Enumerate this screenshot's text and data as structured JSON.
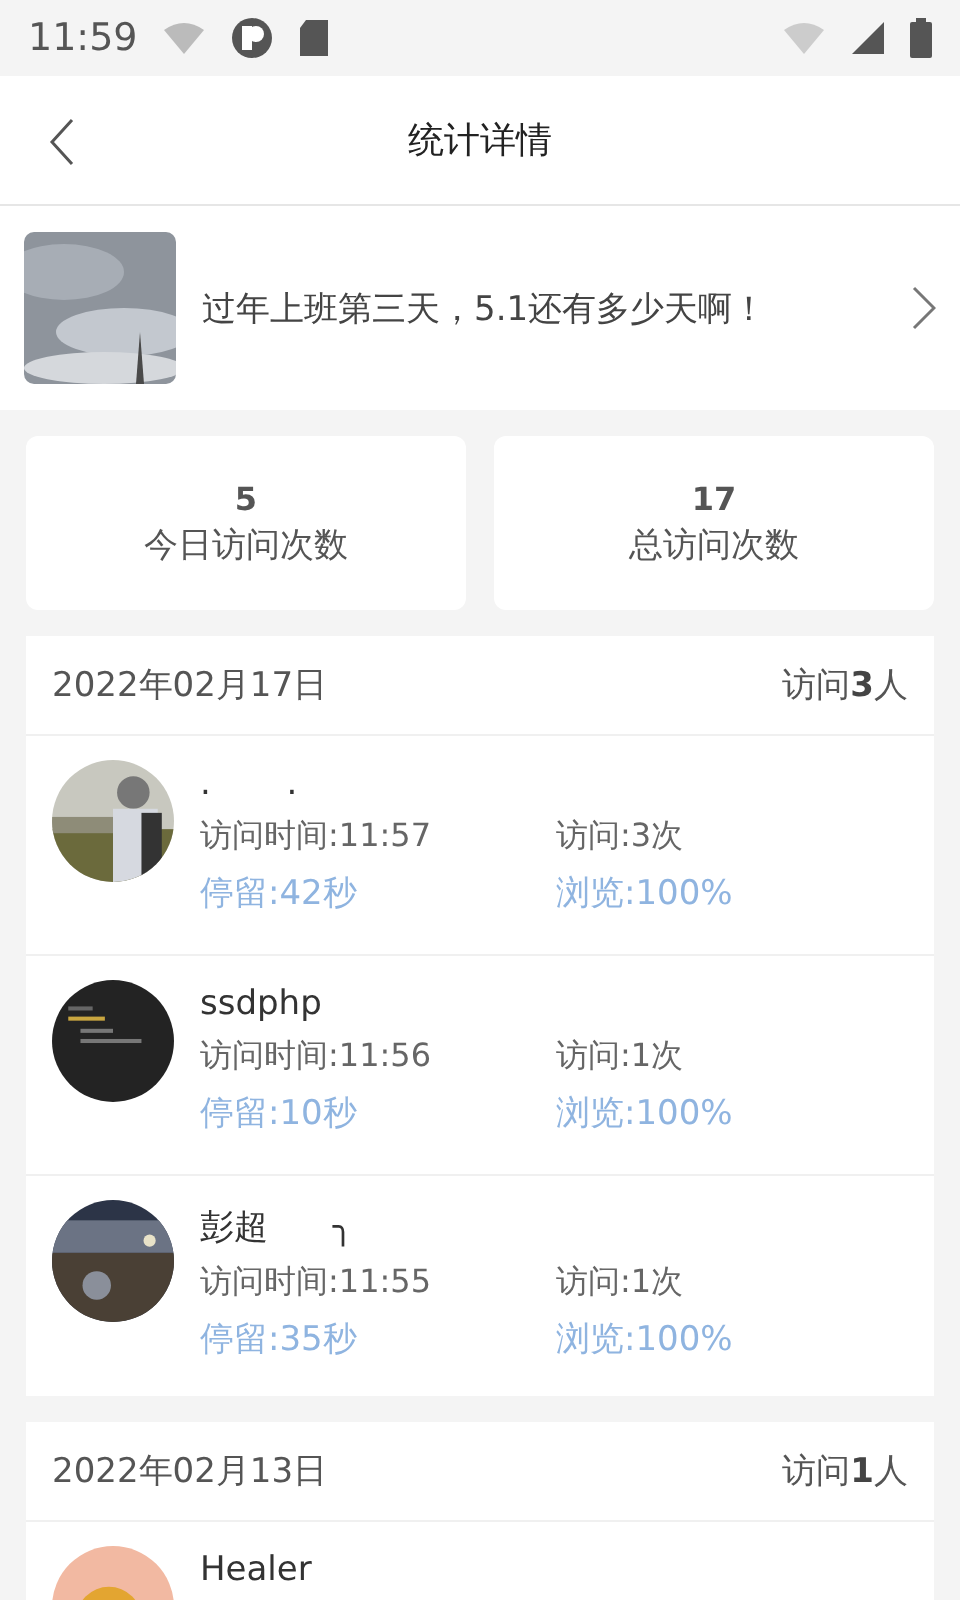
{
  "status_bar": {
    "time": "11:59"
  },
  "header": {
    "title": "统计详情"
  },
  "article": {
    "title": "过年上班第三天，5.1还有多少天啊！"
  },
  "stats": [
    {
      "value": "5",
      "label": "今日访问次数"
    },
    {
      "value": "17",
      "label": "总访问次数"
    }
  ],
  "days": [
    {
      "date": "2022年02月17日",
      "visitors": "访问**3**人",
      "entries": [
        {
          "name": ".       .",
          "time": "访问时间:11:57",
          "visits": "访问:3次",
          "stay": "停留:42秒",
          "browse": "浏览:100%"
        },
        {
          "name": "ssdphp",
          "time": "访问时间:11:56",
          "visits": "访问:1次",
          "stay": "停留:10秒",
          "browse": "浏览:100%"
        },
        {
          "name": "彭超      ╮",
          "time": "访问时间:11:55",
          "visits": "访问:1次",
          "stay": "停留:35秒",
          "browse": "浏览:100%"
        }
      ]
    },
    {
      "date": "2022年02月13日",
      "visitors": "访问**1**人",
      "entries": [
        {
          "name": "Healer"
        }
      ]
    }
  ]
}
